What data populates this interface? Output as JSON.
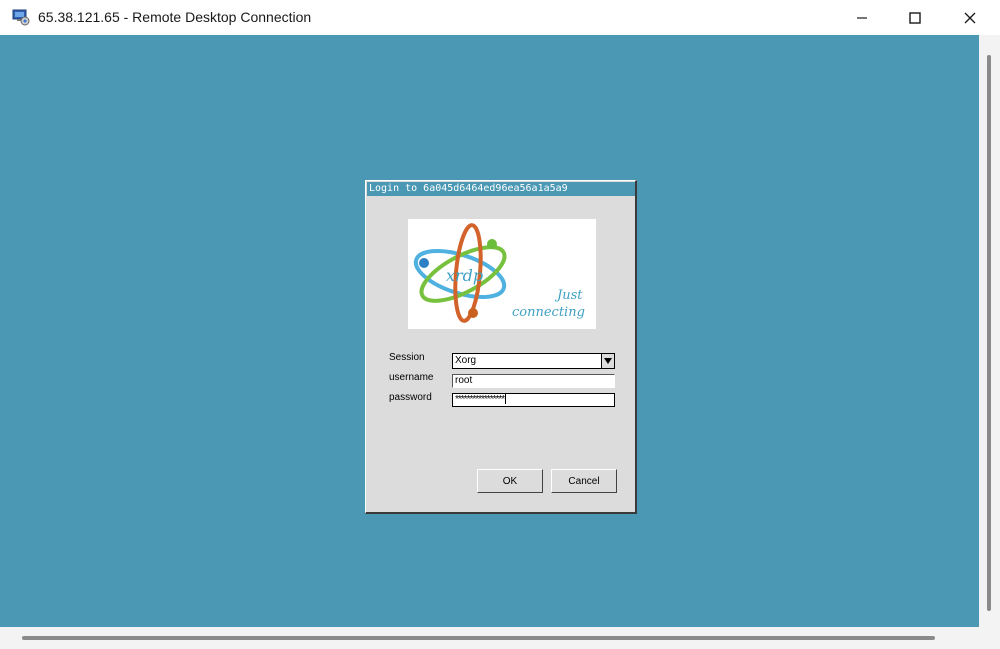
{
  "window": {
    "title": "65.38.121.65 - Remote Desktop Connection",
    "icon": "remote-desktop-icon",
    "controls": [
      "minimize-icon",
      "maximize-icon",
      "close-icon"
    ]
  },
  "desktop": {
    "background": "#4a98b3"
  },
  "login_dialog": {
    "title": "Login to 6a045d6464ed96ea56a1a5a9",
    "logo": {
      "wordmark": "xrdp",
      "tagline_line1": "Just",
      "tagline_line2": "connecting"
    },
    "session": {
      "label": "Session",
      "value": "Xorg"
    },
    "username": {
      "label": "username",
      "value": "root"
    },
    "password": {
      "label": "password",
      "value": "*****************"
    },
    "ok_label": "OK",
    "cancel_label": "Cancel"
  }
}
